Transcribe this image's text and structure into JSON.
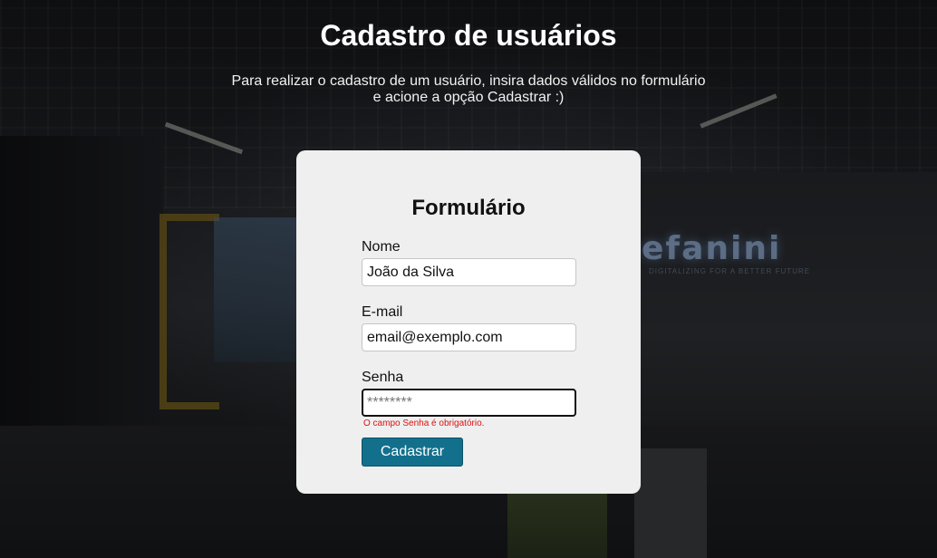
{
  "header": {
    "title": "Cadastro de usuários",
    "subtitle_line1": "Para realizar o cadastro de um usuário, insira dados válidos no formulário",
    "subtitle_line2": "e acione a opção Cadastrar :)"
  },
  "form": {
    "title": "Formulário",
    "nome": {
      "label": "Nome",
      "value": "João da Silva"
    },
    "email": {
      "label": "E-mail",
      "value": "email@exemplo.com"
    },
    "senha": {
      "label": "Senha",
      "value": "",
      "placeholder": "********",
      "error": "O campo Senha é obrigatório."
    },
    "submit_label": "Cadastrar"
  },
  "background": {
    "sign_text": "efanini",
    "sign_subtext": "DIGITALIZING FOR A BETTER FUTURE"
  },
  "colors": {
    "button": "#13708d",
    "error": "#e01010",
    "card": "#efefef"
  }
}
